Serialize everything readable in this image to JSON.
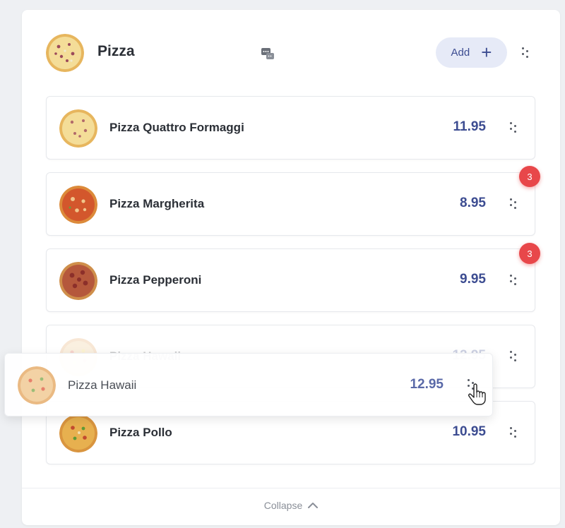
{
  "category": {
    "title": "Pizza",
    "add_label": "Add",
    "add_icon": "plus-icon",
    "menu_icon": "drag-dots-icon",
    "chat_icon": "chat-bubbles-icon"
  },
  "items": [
    {
      "name": "Pizza Quattro Formaggi",
      "price": "11.95",
      "badge": ""
    },
    {
      "name": "Pizza Margherita",
      "price": "8.95",
      "badge": "3"
    },
    {
      "name": "Pizza Pepperoni",
      "price": "9.95",
      "badge": "3"
    },
    {
      "name": "Pizza Hawaii",
      "price": "12.95",
      "badge": ""
    },
    {
      "name": "Pizza Pollo",
      "price": "10.95",
      "badge": ""
    }
  ],
  "dragging": {
    "name": "Pizza Hawaii",
    "price": "12.95"
  },
  "footer": {
    "collapse_label": "Collapse"
  },
  "colors": {
    "accent": "#3c4c91",
    "badge": "#e8474a",
    "add_bg": "#e6eaf7"
  }
}
